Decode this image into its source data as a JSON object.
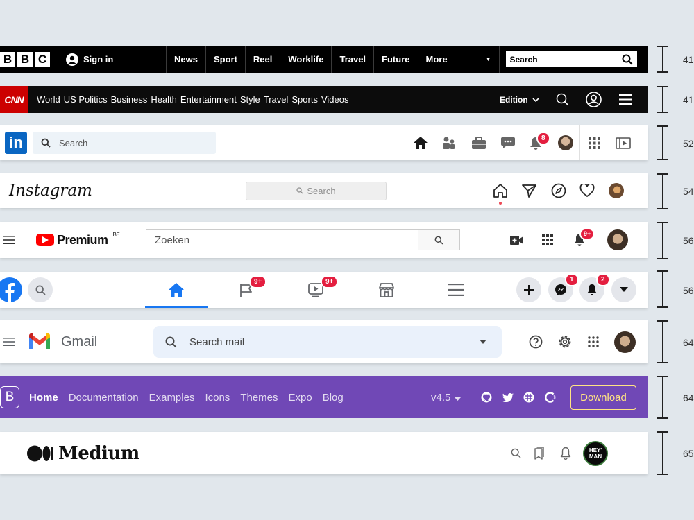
{
  "bbc": {
    "logo": [
      "B",
      "B",
      "C"
    ],
    "sign_in": "Sign in",
    "nav": [
      "News",
      "Sport",
      "Reel",
      "Worklife",
      "Travel",
      "Future",
      "More"
    ],
    "search_placeholder": "Search",
    "height_label": "41"
  },
  "cnn": {
    "logo": "CNN",
    "nav": [
      "World",
      "US Politics",
      "Business",
      "Health",
      "Entertainment",
      "Style",
      "Travel",
      "Sports",
      "Videos"
    ],
    "edition": "Edition",
    "height_label": "41"
  },
  "linkedin": {
    "logo": "in",
    "search_placeholder": "Search",
    "notifications_badge": "8",
    "height_label": "52"
  },
  "instagram": {
    "logo": "Instagram",
    "search_placeholder": "Search",
    "height_label": "54"
  },
  "youtube": {
    "logo": "Premium",
    "region": "BE",
    "search_value": "Zoeken",
    "notifications_badge": "9+",
    "height_label": "56"
  },
  "facebook": {
    "watch_badge": "9+",
    "flag_badge": "9+",
    "messenger_badge": "1",
    "notifications_badge": "2",
    "height_label": "56"
  },
  "gmail": {
    "logo": "Gmail",
    "search_placeholder": "Search mail",
    "height_label": "64"
  },
  "bootstrap": {
    "logo": "B",
    "nav": [
      "Home",
      "Documentation",
      "Examples",
      "Icons",
      "Themes",
      "Expo",
      "Blog"
    ],
    "version": "v4.5",
    "download": "Download",
    "height_label": "64"
  },
  "medium": {
    "logo": "Medium",
    "avatar_text": "HEY' MAN",
    "height_label": "65"
  },
  "colors": {
    "bbc_bg": "#000000",
    "cnn_red": "#cc0000",
    "linkedin_blue": "#0a66c2",
    "youtube_red": "#ff0000",
    "facebook_blue": "#1877f2",
    "bootstrap_purple": "#7048b6",
    "badge_red": "#e41e3f"
  }
}
